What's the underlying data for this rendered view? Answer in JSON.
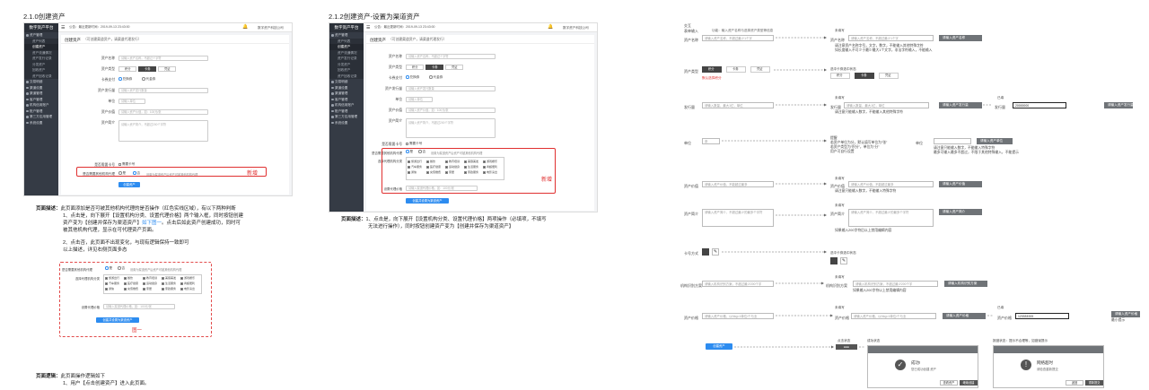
{
  "sections": {
    "s1": "2.1.0创建资产",
    "s2": "2.1.2创建资产-设置为渠道资产"
  },
  "app": {
    "logo": "数字资产平台",
    "notice": "公告：最近更新时间：2019-09-13 23:43:00",
    "company": "数字资产科技公司",
    "user_short": "数字资产公司",
    "sidebar": [
      {
        "label": "资产管理",
        "type": "head"
      },
      {
        "label": "资产列表",
        "type": "sub"
      },
      {
        "label": "创建资产",
        "type": "sub",
        "active": true
      },
      {
        "label": "资产流通情况",
        "type": "sub"
      },
      {
        "label": "资产发行记录",
        "type": "sub"
      },
      {
        "label": "分发资产",
        "type": "sub"
      },
      {
        "label": "回收资产",
        "type": "sub"
      },
      {
        "label": "资产回收记录",
        "type": "sub"
      },
      {
        "label": "交易明细",
        "type": "head"
      },
      {
        "label": "渠道设置",
        "type": "head"
      },
      {
        "label": "渠道管理",
        "type": "head"
      },
      {
        "label": "客户管理",
        "type": "head"
      },
      {
        "label": "机构信用账户",
        "type": "head"
      },
      {
        "label": "账户管理",
        "type": "head"
      },
      {
        "label": "第三方应用管理",
        "type": "head"
      },
      {
        "label": "系统设置",
        "type": "head"
      }
    ],
    "page_title": "创建资产",
    "page_hint": "（可创建渠道资产，请渠道代理发行）"
  },
  "form": {
    "name_label": "资产名称",
    "name_ph": "请输入资产名称，不超过个字符",
    "type_label": "资产类型",
    "type_opts": [
      "积分",
      "卡券",
      "凭证"
    ],
    "bind_label": "卡券支付",
    "bind_opts": [
      "兑换券",
      "代金券"
    ],
    "code_label": "资产发行量",
    "code_ph": "请输入资产发行数量",
    "unit_label": "单位",
    "unit_ph": "请输入单位",
    "desc_label": "资产价值",
    "desc_ph": "请输入资产价值，如：100元/张",
    "intro_label": "资产简介",
    "intro_ph": "请输入资产简介，不超过200个字符",
    "sec_label": "是否需要卡号",
    "sec_opt": "需要卡号",
    "agent_label": "是否需要其他机构代理",
    "agent_yes": "是",
    "agent_no": "否",
    "agent_hint": "设置为渠道资产后资产可被其他机构代理",
    "cat_label": "选择代理机构分类",
    "cats": [
      "旅游出行",
      "餐饮",
      "教育培训",
      "美容美发",
      "游戏娱乐",
      "汽车服务",
      "医疗健康",
      "运动健身",
      "生活服务",
      "商超便利",
      "通信",
      "充值缴费",
      "家居",
      "家政服务",
      "电影演出"
    ],
    "price_label": "设置代理价格",
    "price_ph": "请输入渠道代理价格，如：100元/张",
    "submit": "创建资产",
    "submit2": "创建并设置为渠道资产"
  },
  "labels": {
    "new1": "新增",
    "new2": "新增",
    "fig1": "图一"
  },
  "desc1": {
    "title": "页面描述：",
    "l1": "此页面添加是否可被其他机构代理的是否操作（红色实线区域），有以下两种判断",
    "l2": "1、点击是，向下展开【设置机构分类、设置代理价格】两个输入框，同时按钮创建",
    "l3a": "资产变为【创建并保存为渠道资产】",
    "l3b": "如下图一",
    "l3c": "。点击后如此资产创建成功，同时可",
    "l4": "被其他机构代理，显示在可代理资产页面。",
    "l5": "2、点击否，此页面不出现变化，与现有逻辑保持一致即可",
    "l6": "以上描述，详见右侧页面多态"
  },
  "desc2": {
    "title": "页面描述：",
    "l1": "1、点击是，向下展开【设置机构分类、设置代理价格】两项操作（必填项，不填写",
    "l2": "无法进行操作），同时按钮创建资产变为【创建并保存为渠道资产】"
  },
  "logic": {
    "title": "页面逻辑：",
    "l1": "此页面操作逻辑如下",
    "l2": "1、用户【点击创建资产】进入此页面。"
  },
  "right": {
    "h1": "交互",
    "h2": "表单输入",
    "h3": "功能：输入资产名称与选择资产类型等信息",
    "state_default": "未填写",
    "state_filled": "已填",
    "state_error": "报错",
    "name_label": "资产名称",
    "name_ph": "请输入资产名称，不超过最少1个字",
    "name_err": "请输入资产名称",
    "name_rule1": "请注意资产名称字号，文字，数字，不能输入其他特殊字符",
    "name_rule2": "如长度输入不可少于最少最大1个文字，非法字符输入，不能输入",
    "type_label": "资产类型",
    "type_default": "默认选择积分",
    "type_rule": "选中卡券选中状态",
    "issue_label": "发行量",
    "issue_ph": "请输入数量，最大1亿，单位",
    "issue_rule": "请注意只能输入数字，不能输入其他特殊字符",
    "issue_val": "20000000",
    "issue_err": "请输入资产发行量",
    "unit_label": "单位",
    "unit_val": "张",
    "unit_note1": "提醒",
    "unit_note2": "若资产单位为分，默认填写单位为“张”",
    "unit_note3": "若资产类型为“积分”，单位为“分”",
    "unit_note4": "用户可自行设置",
    "unit_err": "请输入资产单位",
    "unit_rule1": "请注意只能输入数字，不能输入特殊字符",
    "unit_rule2": "最多可输入最多不超过，不限于其他特殊输入，不能提示",
    "value_label": "资产价值",
    "value_ph": "请输入资产价值，不能超过最多",
    "value_rule": "请注意只能输入数字，不能输入特殊字符",
    "value_err": "请输入资产价值",
    "intro_label": "资产简介",
    "intro_ph": "请输入资产简介，不超过最少的最多个字符",
    "intro_rule": "如果输入200字符后以上禁用编辑内容",
    "card_label": "卡号方式",
    "card_rule": "选中卡券选中状态",
    "id_label": "机构识别方案",
    "id_ph": "请输入机构识别方案，不超过最少200个字",
    "id_rule": "如果输入200字符以上禁用编辑内容",
    "id_err": "请输入机构识别方案",
    "price_label": "资产价格",
    "price_ph": "请输入资产价格，以Nkg=1单位/个与业",
    "price_val": "123333333",
    "price_ph2": "请输入资产价格，以Nkg=1单位/个与业",
    "price_err": "请输入资产价格",
    "hint_pos": "最小提示",
    "create_btn": "创建资产",
    "clicked": "点击状态",
    "success_h": "成功状态",
    "fail_h": "报错状态：提示不合理等，如错误提示",
    "dlg_ok_title": "成功!",
    "dlg_ok_msg": "您已成功创建 资产",
    "dlg_ok_b1": "查看资产",
    "dlg_ok_b2": "继续创建",
    "dlg_fail_title": "网络超时",
    "dlg_fail_msg": "请检查重新提交",
    "dlg_fail_b1": "返回",
    "dlg_fail_b2": "重新提交"
  }
}
